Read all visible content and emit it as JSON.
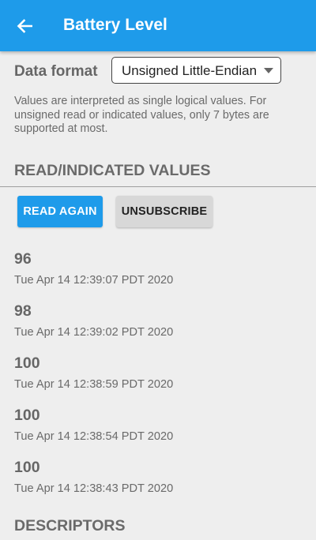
{
  "appbar": {
    "title": "Battery Level",
    "back_icon": "arrow-left-icon",
    "color": "#1e9bea"
  },
  "data_format": {
    "label": "Data format",
    "selected": "Unsigned Little-Endian"
  },
  "note": "Values are interpreted as single logical values. For unsigned read or indicated values, only 7 bytes are supported at most.",
  "values_section": {
    "heading": "READ/INDICATED VALUES",
    "read_again": "READ AGAIN",
    "unsubscribe": "UNSUBSCRIBE",
    "readings": [
      {
        "value": "96",
        "time": "Tue Apr 14 12:39:07 PDT 2020"
      },
      {
        "value": "98",
        "time": "Tue Apr 14 12:39:02 PDT 2020"
      },
      {
        "value": "100",
        "time": "Tue Apr 14 12:38:59 PDT 2020"
      },
      {
        "value": "100",
        "time": "Tue Apr 14 12:38:54 PDT 2020"
      },
      {
        "value": "100",
        "time": "Tue Apr 14 12:38:43 PDT 2020"
      }
    ]
  },
  "descriptors_section": {
    "heading": "DESCRIPTORS"
  }
}
